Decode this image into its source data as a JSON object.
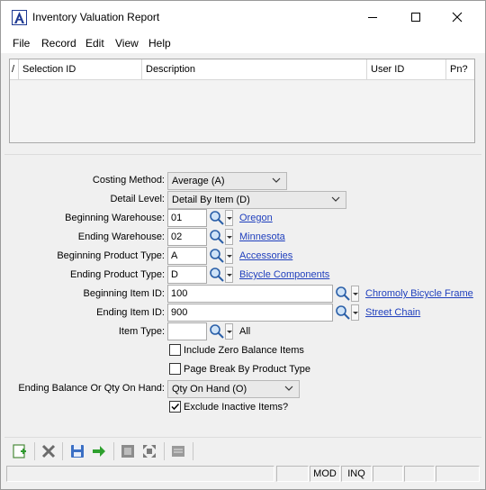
{
  "window": {
    "title": "Inventory Valuation Report"
  },
  "menu": [
    "File",
    "Record",
    "Edit",
    "View",
    "Help"
  ],
  "grid": {
    "columns": [
      "Selection ID",
      "Description",
      "User ID",
      "Pn?"
    ]
  },
  "form": {
    "costing_method": {
      "label": "Costing Method:",
      "value": "Average (A)"
    },
    "detail_level": {
      "label": "Detail Level:",
      "value": "Detail By Item (D)"
    },
    "beginning_warehouse": {
      "label": "Beginning Warehouse:",
      "value": "01",
      "link": "Oregon"
    },
    "ending_warehouse": {
      "label": "Ending Warehouse:",
      "value": "02",
      "link": "Minnesota"
    },
    "beginning_product_type": {
      "label": "Beginning Product Type:",
      "value": "A",
      "link": "Accessories"
    },
    "ending_product_type": {
      "label": "Ending Product Type:",
      "value": "D",
      "link": "Bicycle Components"
    },
    "beginning_item_id": {
      "label": "Beginning Item ID:",
      "value": "100",
      "link": "Chromoly Bicycle Frame"
    },
    "ending_item_id": {
      "label": "Ending Item ID:",
      "value": "900",
      "link": "Street Chain"
    },
    "item_type": {
      "label": "Item Type:",
      "value": "",
      "text": "All"
    },
    "include_zero": {
      "label": "Include Zero Balance Items",
      "checked": false
    },
    "page_break": {
      "label": "Page Break By Product Type",
      "checked": false
    },
    "ending_balance": {
      "label": "Ending Balance Or Qty On Hand:",
      "value": "Qty On Hand (O)"
    },
    "exclude_inactive": {
      "label": "Exclude Inactive Items?",
      "checked": true
    }
  },
  "status": {
    "mod": "MOD",
    "inq": "INQ"
  },
  "colors": {
    "link": "#1f3fbd",
    "accent": "#1f3a93"
  }
}
